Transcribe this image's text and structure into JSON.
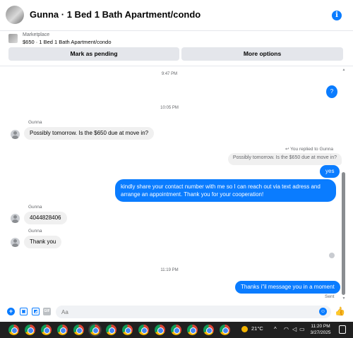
{
  "header": {
    "title": "Gunna · 1 Bed 1 Bath Apartment/condo"
  },
  "marketplace": {
    "label": "Marketplace",
    "listing": "$650 · 1 Bed 1 Bath Apartment/condo",
    "mark_pending": "Mark as pending",
    "more_options": "More options"
  },
  "messages": {
    "ts1": "9:47 PM",
    "bubble_question": "?",
    "ts2": "10:05 PM",
    "sender1": "Gunna",
    "in1": "Possibly tomorrow. Is the $650 due at move in?",
    "reply_note": "You replied to Gunna",
    "quoted": "Possibly tomorrow. Is the $650 due at move in?",
    "out_yes": "yes",
    "out_long": "kindly share your contact number with me so I can reach out via text adress and arrange an appointment. Thank you for your cooperation!",
    "sender2": "Gunna",
    "in2": "4044828406",
    "sender3": "Gunna",
    "in3": "Thank you",
    "ts3": "11:19 PM",
    "out_last": "Thanks i\"il message you in a moment",
    "status": "Sent"
  },
  "composer": {
    "placeholder": "Aa"
  },
  "taskbar": {
    "temperature": "21°C",
    "time": "11:20 PM",
    "date": "3/27/2025"
  },
  "colors": {
    "accent": "#0a7cff",
    "incoming": "#f0f0f0",
    "taskbar": "#202020"
  },
  "icons": [
    "info-icon",
    "plus-icon",
    "photo-icon",
    "sticker-icon",
    "gif-icon",
    "emoji-icon",
    "thumbs-up-icon",
    "reply-icon",
    "chrome-icon",
    "weather-icon",
    "chevron-up-icon",
    "wifi-icon",
    "speaker-icon",
    "battery-icon",
    "notification-icon"
  ]
}
